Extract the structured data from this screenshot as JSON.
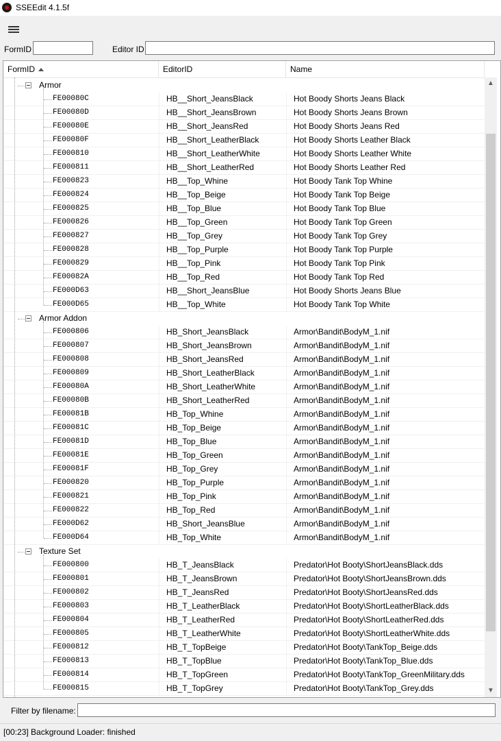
{
  "window": {
    "title": "SSEEdit 4.1.5f"
  },
  "search": {
    "formid_label": "FormID",
    "editorid_label": "Editor ID",
    "formid_value": "",
    "editorid_value": ""
  },
  "columns": [
    "FormID",
    "EditorID",
    "Name"
  ],
  "groups": [
    {
      "label": "Armor",
      "rows": [
        [
          "FE00080C",
          "HB__Short_JeansBlack",
          "Hot Boody Shorts Jeans Black"
        ],
        [
          "FE00080D",
          "HB__Short_JeansBrown",
          "Hot Boody Shorts Jeans Brown"
        ],
        [
          "FE00080E",
          "HB__Short_JeansRed",
          "Hot Boody Shorts Jeans Red"
        ],
        [
          "FE00080F",
          "HB__Short_LeatherBlack",
          "Hot Boody Shorts Leather Black"
        ],
        [
          "FE000810",
          "HB__Short_LeatherWhite",
          "Hot Boody Shorts Leather White"
        ],
        [
          "FE000811",
          "HB__Short_LeatherRed",
          "Hot Boody Shorts Leather Red"
        ],
        [
          "FE000823",
          "HB__Top_Whine",
          "Hot Boody Tank Top Whine"
        ],
        [
          "FE000824",
          "HB__Top_Beige",
          "Hot Boody Tank Top Beige"
        ],
        [
          "FE000825",
          "HB__Top_Blue",
          "Hot Boody Tank Top Blue"
        ],
        [
          "FE000826",
          "HB__Top_Green",
          "Hot Boody Tank Top Green"
        ],
        [
          "FE000827",
          "HB__Top_Grey",
          "Hot Boody Tank Top Grey"
        ],
        [
          "FE000828",
          "HB__Top_Purple",
          "Hot Boody Tank Top Purple"
        ],
        [
          "FE000829",
          "HB__Top_Pink",
          "Hot Boody Tank Top Pink"
        ],
        [
          "FE00082A",
          "HB__Top_Red",
          "Hot Boody Tank Top Red"
        ],
        [
          "FE000D63",
          "HB__Short_JeansBlue",
          "Hot Boody Shorts Jeans Blue"
        ],
        [
          "FE000D65",
          "HB__Top_White",
          "Hot Boody Tank Top White"
        ]
      ]
    },
    {
      "label": "Armor Addon",
      "rows": [
        [
          "FE000806",
          "HB_Short_JeansBlack",
          "Armor\\Bandit\\BodyM_1.nif"
        ],
        [
          "FE000807",
          "HB_Short_JeansBrown",
          "Armor\\Bandit\\BodyM_1.nif"
        ],
        [
          "FE000808",
          "HB_Short_JeansRed",
          "Armor\\Bandit\\BodyM_1.nif"
        ],
        [
          "FE000809",
          "HB_Short_LeatherBlack",
          "Armor\\Bandit\\BodyM_1.nif"
        ],
        [
          "FE00080A",
          "HB_Short_LeatherWhite",
          "Armor\\Bandit\\BodyM_1.nif"
        ],
        [
          "FE00080B",
          "HB_Short_LeatherRed",
          "Armor\\Bandit\\BodyM_1.nif"
        ],
        [
          "FE00081B",
          "HB_Top_Whine",
          "Armor\\Bandit\\BodyM_1.nif"
        ],
        [
          "FE00081C",
          "HB_Top_Beige",
          "Armor\\Bandit\\BodyM_1.nif"
        ],
        [
          "FE00081D",
          "HB_Top_Blue",
          "Armor\\Bandit\\BodyM_1.nif"
        ],
        [
          "FE00081E",
          "HB_Top_Green",
          "Armor\\Bandit\\BodyM_1.nif"
        ],
        [
          "FE00081F",
          "HB_Top_Grey",
          "Armor\\Bandit\\BodyM_1.nif"
        ],
        [
          "FE000820",
          "HB_Top_Purple",
          "Armor\\Bandit\\BodyM_1.nif"
        ],
        [
          "FE000821",
          "HB_Top_Pink",
          "Armor\\Bandit\\BodyM_1.nif"
        ],
        [
          "FE000822",
          "HB_Top_Red",
          "Armor\\Bandit\\BodyM_1.nif"
        ],
        [
          "FE000D62",
          "HB_Short_JeansBlue",
          "Armor\\Bandit\\BodyM_1.nif"
        ],
        [
          "FE000D64",
          "HB_Top_White",
          "Armor\\Bandit\\BodyM_1.nif"
        ]
      ]
    },
    {
      "label": "Texture Set",
      "rows": [
        [
          "FE000800",
          "HB_T_JeansBlack",
          "Predator\\Hot Booty\\ShortJeansBlack.dds"
        ],
        [
          "FE000801",
          "HB_T_JeansBrown",
          "Predator\\Hot Booty\\ShortJeansBrown.dds"
        ],
        [
          "FE000802",
          "HB_T_JeansRed",
          "Predator\\Hot Booty\\ShortJeansRed.dds"
        ],
        [
          "FE000803",
          "HB_T_LeatherBlack",
          "Predator\\Hot Booty\\ShortLeatherBlack.dds"
        ],
        [
          "FE000804",
          "HB_T_LeatherRed",
          "Predator\\Hot Booty\\ShortLeatherRed.dds"
        ],
        [
          "FE000805",
          "HB_T_LeatherWhite",
          "Predator\\Hot Booty\\ShortLeatherWhite.dds"
        ],
        [
          "FE000812",
          "HB_T_TopBeige",
          "Predator\\Hot Booty\\TankTop_Beige.dds"
        ],
        [
          "FE000813",
          "HB_T_TopBlue",
          "Predator\\Hot Booty\\TankTop_Blue.dds"
        ],
        [
          "FE000814",
          "HB_T_TopGreen",
          "Predator\\Hot Booty\\TankTop_GreenMilitary.dds"
        ],
        [
          "FE000815",
          "HB_T_TopGrey",
          "Predator\\Hot Booty\\TankTop_Grey.dds"
        ]
      ]
    }
  ],
  "filter": {
    "label": "Filter by filename:",
    "value": ""
  },
  "status": {
    "text": "[00:23] Background Loader: finished"
  }
}
